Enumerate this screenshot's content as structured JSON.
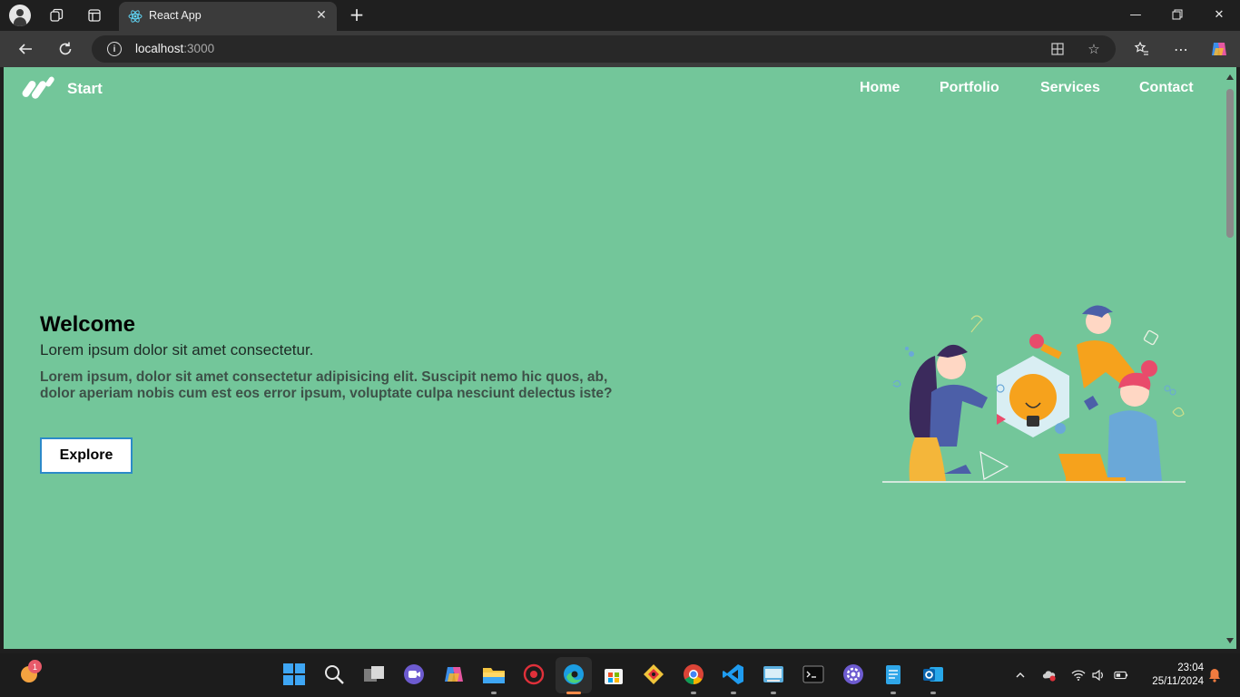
{
  "browser": {
    "tab_title": "React App",
    "url_host": "localhost",
    "url_port": ":3000"
  },
  "page": {
    "brand": "Start",
    "nav": [
      "Home",
      "Portfolio",
      "Services",
      "Contact"
    ],
    "hero": {
      "title": "Welcome",
      "subtitle": "Lorem ipsum dolor sit amet consectetur.",
      "text": "Lorem ipsum, dolor sit amet consectetur adipisicing elit. Suscipit nemo hic quos, ab, dolor aperiam nobis cum est eos error ipsum, voluptate culpa nesciunt delectus iste?",
      "button": "Explore"
    },
    "colors": {
      "background": "#73c69a",
      "button_border": "#2c8ac9"
    }
  },
  "taskbar": {
    "time": "23:04",
    "date": "25/11/2024",
    "weather_badge": "1",
    "apps": [
      "widgets",
      "start",
      "search",
      "task-view",
      "meet",
      "copilot",
      "file-explorer",
      "app-red",
      "edge",
      "store",
      "git",
      "chrome",
      "vscode",
      "app-drive",
      "terminal",
      "app-gear",
      "notepad",
      "outlook"
    ]
  }
}
